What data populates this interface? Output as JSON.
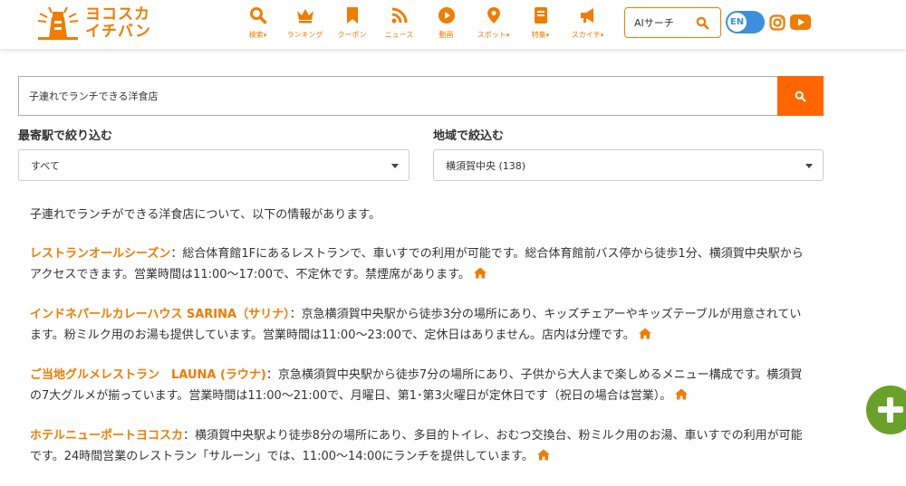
{
  "header": {
    "logo_text_line1": "ヨコスカ",
    "logo_text_line2": "イチバン",
    "nav": [
      {
        "label": "検索",
        "chevron": "▾",
        "icon": "search-icon"
      },
      {
        "label": "ランキング",
        "chevron": "",
        "icon": "crown-icon"
      },
      {
        "label": "クーポン",
        "chevron": "",
        "icon": "bookmark-icon"
      },
      {
        "label": "ニュース",
        "chevron": "",
        "icon": "rss-icon"
      },
      {
        "label": "動画",
        "chevron": "",
        "icon": "play-icon"
      },
      {
        "label": "スポット",
        "chevron": "▾",
        "icon": "map-pin-icon"
      },
      {
        "label": "特集",
        "chevron": "▾",
        "icon": "book-icon"
      },
      {
        "label": "スカイチ",
        "chevron": "▾",
        "icon": "megaphone-icon"
      }
    ],
    "ai_search_label": "AIサーチ",
    "lang_toggle": "EN"
  },
  "search": {
    "query": "子連れでランチできる洋食店"
  },
  "filters": {
    "station_label": "最寄駅で絞り込む",
    "station_value": "すべて",
    "area_label": "地域で絞込む",
    "area_value": "横須賀中央 (138)"
  },
  "result": {
    "intro": "子連れでランチができる洋食店について、以下の情報があります。",
    "entries": [
      {
        "name": "レストランオールシーズン",
        "text": "：総合体育館1Fにあるレストランで、車いすでの利用が可能です。総合体育館前バス停から徒歩1分、横須賀中央駅からアクセスできます。営業時間は11:00～17:00で、不定休です。禁煙席があります。"
      },
      {
        "name": "インドネパールカレーハウス SARINA（サリナ）",
        "text": "：京急横須賀中央駅から徒歩3分の場所にあり、キッズチェアーやキッズテーブルが用意されています。粉ミルク用のお湯も提供しています。営業時間は11:00～23:00で、定休日はありません。店内は分煙です。"
      },
      {
        "name": "ご当地グルメレストラン　LAUNA (ラウナ)",
        "text": "：京急横須賀中央駅から徒歩7分の場所にあり、子供から大人まで楽しめるメニュー構成です。横須賀の7大グルメが揃っています。営業時間は11:00～21:00で、月曜日、第1･第3火曜日が定休日です（祝日の場合は営業）。"
      },
      {
        "name": "ホテルニューポートヨコスカ",
        "text": "：横須賀中央駅より徒歩8分の場所にあり、多目的トイレ、おむつ交換台、粉ミルク用のお湯、車いすでの利用が可能です。24時間営業のレストラン「サルーン」では、11:00～14:00にランチを提供しています。"
      }
    ]
  },
  "colors": {
    "brand_orange": "#f07c00",
    "search_button": "#ff6600",
    "fab_green": "#6aa229",
    "toggle_blue": "#3c8fdc"
  }
}
